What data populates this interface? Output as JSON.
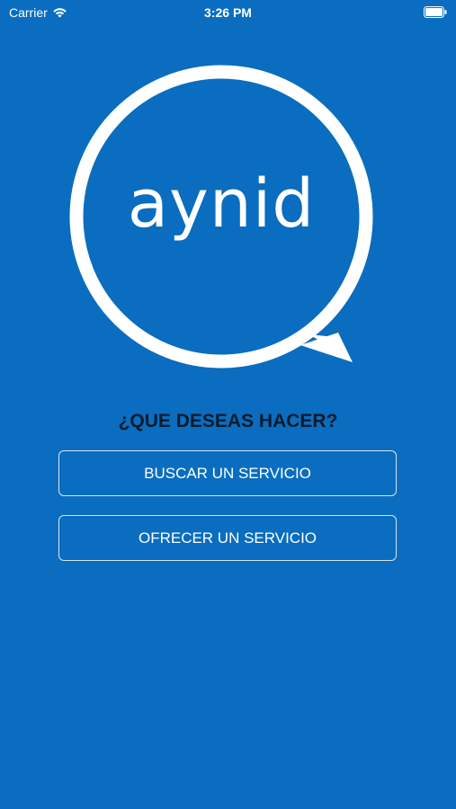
{
  "status_bar": {
    "carrier": "Carrier",
    "time": "3:26 PM",
    "wifi_icon": "wifi-icon",
    "battery_icon": "battery-icon"
  },
  "logo": {
    "text": "aynid",
    "icon": "speech-bubble-icon"
  },
  "main": {
    "question": "¿QUE DESEAS HACER?",
    "buttons": {
      "search_service": "BUSCAR UN SERVICIO",
      "offer_service": "OFRECER UN SERVICIO"
    }
  },
  "colors": {
    "background": "#0a6dbf",
    "text_dark": "#0b1a2b",
    "white": "#ffffff"
  }
}
